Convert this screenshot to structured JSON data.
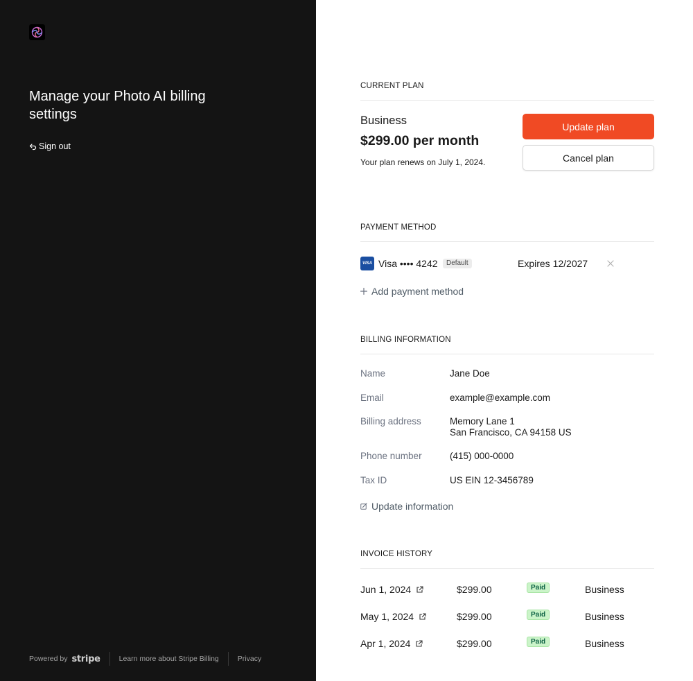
{
  "sidebar": {
    "headline": "Manage your Photo AI billing settings",
    "sign_out": "Sign out",
    "footer": {
      "powered_by": "Powered by",
      "stripe": "stripe",
      "learn_more": "Learn more about Stripe Billing",
      "privacy": "Privacy"
    }
  },
  "current_plan": {
    "title": "CURRENT PLAN",
    "name": "Business",
    "price": "$299.00 per month",
    "renewal": "Your plan renews on July 1, 2024.",
    "update_button": "Update plan",
    "cancel_button": "Cancel plan"
  },
  "payment_method": {
    "title": "PAYMENT METHOD",
    "card_brand_logo": "VISA",
    "card_label": "Visa •••• 4242",
    "default_badge": "Default",
    "expires": "Expires 12/2027",
    "add_label": "Add payment method"
  },
  "billing_information": {
    "title": "BILLING INFORMATION",
    "fields": [
      {
        "label": "Name",
        "value": "Jane Doe"
      },
      {
        "label": "Email",
        "value": "example@example.com"
      },
      {
        "label": "Billing address",
        "value_line1": "Memory Lane 1",
        "value_line2": "San Francisco, CA 94158 US"
      },
      {
        "label": "Phone number",
        "value": "(415) 000-0000"
      },
      {
        "label": "Tax ID",
        "value": "US EIN 12-3456789"
      }
    ],
    "update_label": "Update information"
  },
  "invoice_history": {
    "title": "INVOICE HISTORY",
    "rows": [
      {
        "date": "Jun 1, 2024",
        "amount": "$299.00",
        "status": "Paid",
        "plan": "Business"
      },
      {
        "date": "May 1, 2024",
        "amount": "$299.00",
        "status": "Paid",
        "plan": "Business"
      },
      {
        "date": "Apr 1, 2024",
        "amount": "$299.00",
        "status": "Paid",
        "plan": "Business"
      }
    ]
  },
  "colors": {
    "sidebar_bg": "#141414",
    "primary_button": "#f04a24",
    "paid_badge_bg": "#cbf4c9",
    "paid_badge_text": "#0e6245",
    "visa_blue": "#1a4ea1"
  },
  "icons": [
    "app-logo-icon",
    "sign-out-arrow-icon",
    "visa-card-icon",
    "close-icon",
    "plus-icon",
    "edit-icon",
    "external-link-icon"
  ]
}
